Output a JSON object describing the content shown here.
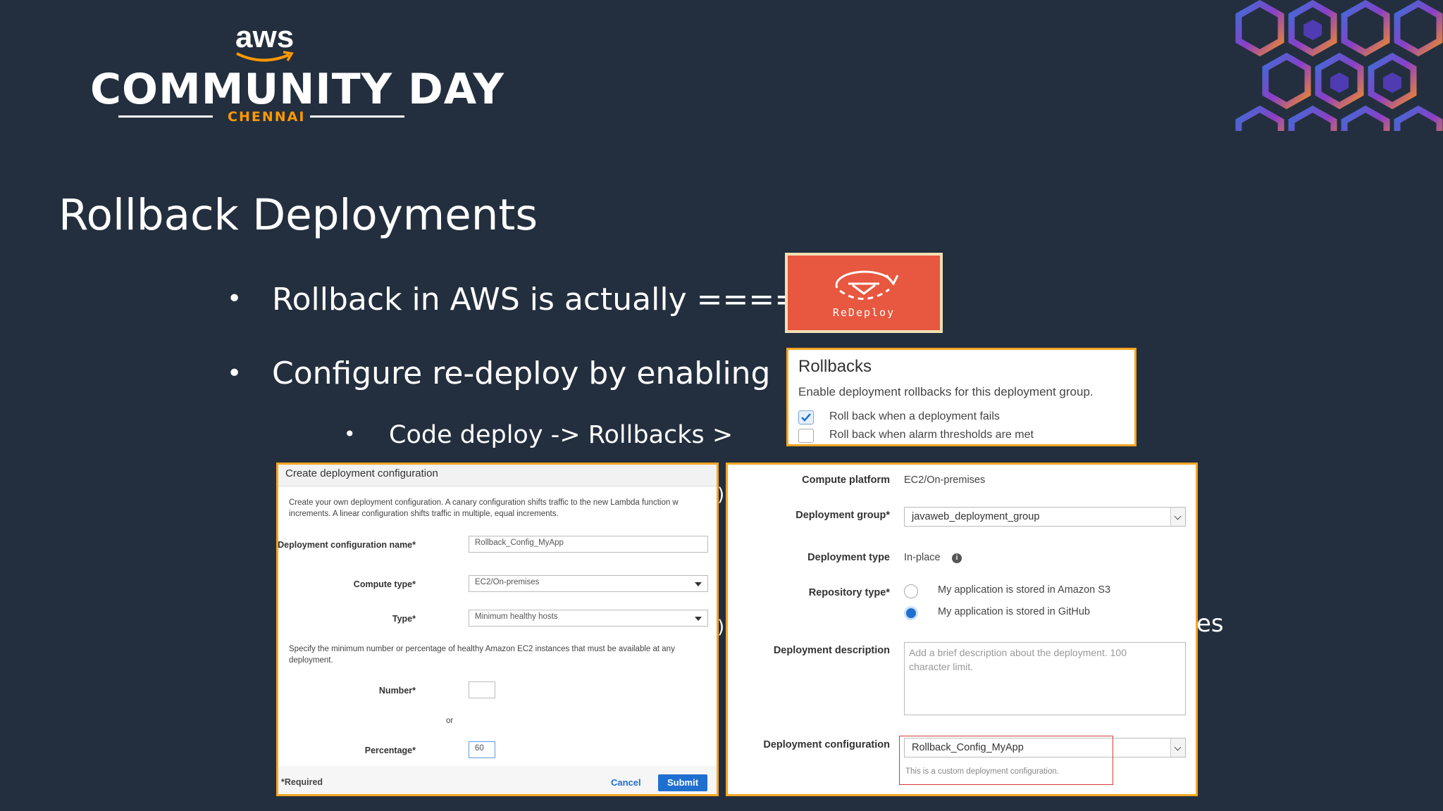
{
  "logo": {
    "aws": "aws",
    "event": "COMMUNITY DAY",
    "city": "CHENNAI"
  },
  "slide": {
    "title": "Rollback Deployments",
    "bullets": [
      "Rollback in AWS is actually  ====>",
      "Configure re-deploy by enabling"
    ],
    "sub_bullets": [
      "Code deploy -> Rollbacks >"
    ],
    "partial_text": [
      ")",
      ")",
      "es"
    ]
  },
  "redeploy_icon": {
    "label": "ReDeploy",
    "color": "#e8573f"
  },
  "rollbacks": {
    "title": "Rollbacks",
    "description": "Enable deployment rollbacks for this deployment group.",
    "options": [
      {
        "label": "Roll back when a deployment fails",
        "checked": true
      },
      {
        "label": "Roll back when alarm thresholds are met",
        "checked": false
      }
    ]
  },
  "create_config": {
    "header": "Create deployment configuration",
    "intro": "Create your own deployment configuration. A canary configuration shifts traffic to the new Lambda function w",
    "intro2": "increments. A linear configuration shifts traffic in multiple, equal increments.",
    "name_label": "Deployment configuration name*",
    "name_value": "Rollback_Config_MyApp",
    "compute_label": "Compute type*",
    "compute_value": "EC2/On-premises",
    "type_label": "Type*",
    "type_value": "Minimum healthy hosts",
    "specify_text": "Specify the minimum number or percentage of healthy Amazon EC2 instances that must be available at any",
    "specify_text2": "deployment.",
    "number_label": "Number*",
    "number_value": "",
    "or_text": "or",
    "percentage_label": "Percentage*",
    "percentage_value": "60",
    "required_note": "*Required",
    "cancel_label": "Cancel",
    "submit_label": "Submit"
  },
  "deployment": {
    "compute_platform_label": "Compute platform",
    "compute_platform_value": "EC2/On-premises",
    "group_label": "Deployment group*",
    "group_value": "javaweb_deployment_group",
    "type_label": "Deployment type",
    "type_value": "In-place",
    "repo_label": "Repository type*",
    "repo_options": [
      {
        "label": "My application is stored in Amazon S3",
        "selected": false
      },
      {
        "label": "My application is stored in GitHub",
        "selected": true
      }
    ],
    "description_label": "Deployment description",
    "description_placeholder_1": "Add a brief description about the deployment. 100",
    "description_placeholder_2": "character limit.",
    "config_label": "Deployment configuration",
    "config_value": "Rollback_Config_MyApp",
    "config_note": "This is a custom deployment configuration."
  },
  "colors": {
    "background": "#232f3e",
    "accent_orange": "#ff9900",
    "panel_border": "#f5a623",
    "button_blue": "#1f6fd1",
    "highlight_red": "#d43a3a"
  }
}
